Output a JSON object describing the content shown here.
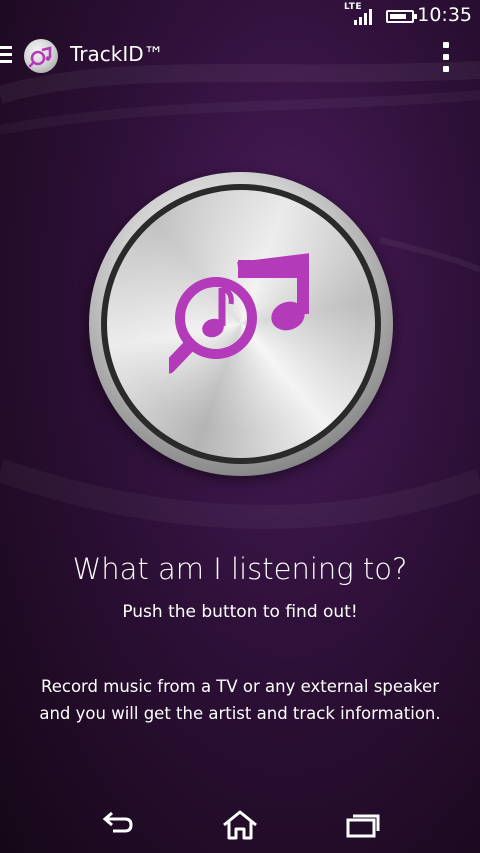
{
  "status_bar": {
    "network": "LTE",
    "time": "10:35",
    "battery_level": 0.85
  },
  "app_bar": {
    "title": "TrackID™"
  },
  "main": {
    "headline": "What am I listening to?",
    "subheadline": "Push the button to find out!",
    "description": "Record music from a TV or any external speaker and you will get the artist and track information."
  },
  "icons": {
    "menu": "menu-icon",
    "app_logo": "trackid-logo-icon",
    "overflow": "overflow-menu-icon",
    "record_button": "trackid-search-music-icon",
    "back": "back-icon",
    "home": "home-icon",
    "recents": "recent-apps-icon"
  },
  "colors": {
    "accent": "#b33ab8",
    "background": "#2e1038"
  }
}
